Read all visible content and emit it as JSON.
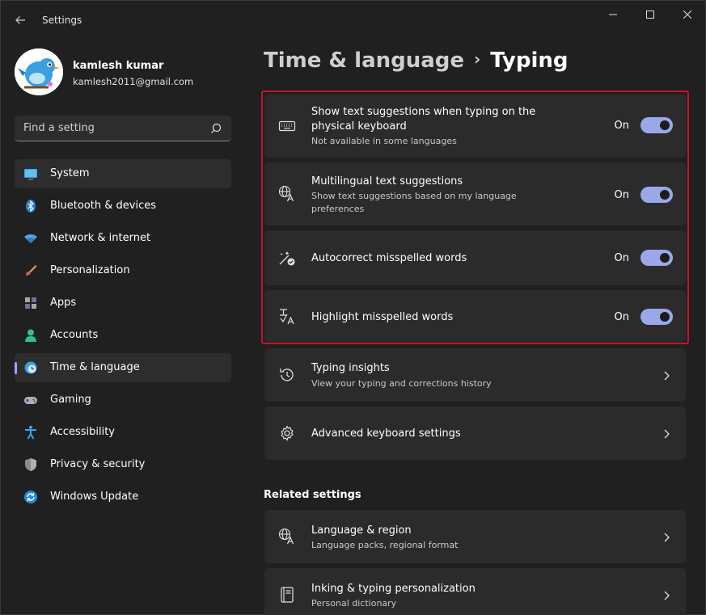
{
  "window": {
    "title": "Settings",
    "controls": {
      "minimize": "minimize",
      "maximize": "maximize",
      "close": "close"
    }
  },
  "profile": {
    "name": "kamlesh kumar",
    "email": "kamlesh2011@gmail.com"
  },
  "search": {
    "placeholder": "Find a setting"
  },
  "nav": {
    "items": [
      {
        "label": "System",
        "icon": "system-icon"
      },
      {
        "label": "Bluetooth & devices",
        "icon": "bluetooth-icon"
      },
      {
        "label": "Network & internet",
        "icon": "wifi-icon"
      },
      {
        "label": "Personalization",
        "icon": "brush-icon"
      },
      {
        "label": "Apps",
        "icon": "apps-icon"
      },
      {
        "label": "Accounts",
        "icon": "person-icon"
      },
      {
        "label": "Time & language",
        "icon": "clock-globe-icon",
        "active": true
      },
      {
        "label": "Gaming",
        "icon": "gamepad-icon"
      },
      {
        "label": "Accessibility",
        "icon": "accessibility-icon"
      },
      {
        "label": "Privacy & security",
        "icon": "shield-icon"
      },
      {
        "label": "Windows Update",
        "icon": "update-icon"
      }
    ]
  },
  "breadcrumb": {
    "parent": "Time & language",
    "separator": "›",
    "current": "Typing"
  },
  "settings": [
    {
      "title": "Show text suggestions when typing on the",
      "title2": "physical keyboard",
      "desc": "Not available in some languages",
      "toggle": "On",
      "icon": "keyboard-icon"
    },
    {
      "title": "Multilingual text suggestions",
      "desc": "Show text suggestions based on my language",
      "desc2": "preferences",
      "toggle": "On",
      "icon": "language-icon"
    },
    {
      "title": "Autocorrect misspelled words",
      "toggle": "On",
      "icon": "autocorrect-icon"
    },
    {
      "title": "Highlight misspelled words",
      "toggle": "On",
      "icon": "highlight-icon"
    },
    {
      "title": "Typing insights",
      "desc": "View your typing and corrections history",
      "icon": "history-icon"
    },
    {
      "title": "Advanced keyboard settings",
      "icon": "gear-icon"
    }
  ],
  "related": {
    "heading": "Related settings",
    "items": [
      {
        "title": "Language & region",
        "desc": "Language packs, regional format",
        "icon": "language-icon"
      },
      {
        "title": "Inking & typing personalization",
        "desc": "Personal dictionary",
        "icon": "book-icon"
      }
    ]
  },
  "colors": {
    "accent": "#9aa8e8",
    "highlight_border": "#c8102e",
    "card_bg": "#2b2b2b",
    "window_bg": "#202020"
  }
}
